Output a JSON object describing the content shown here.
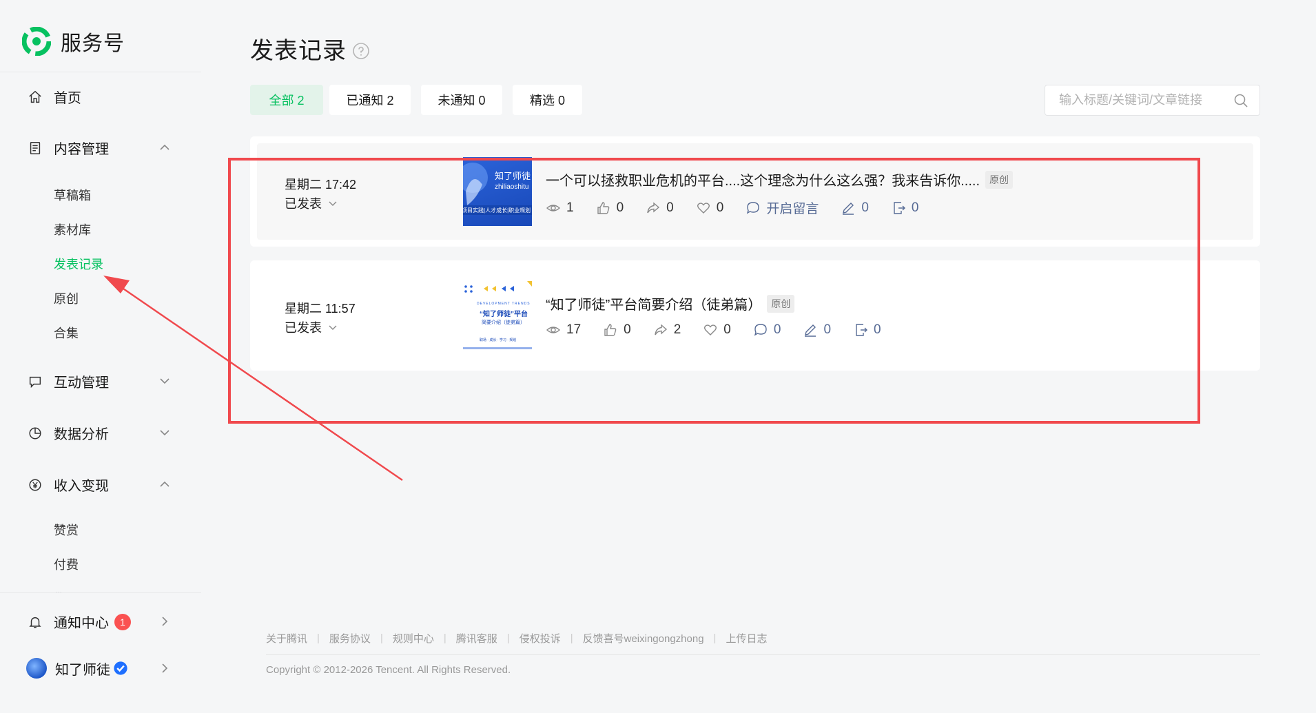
{
  "brand": {
    "name": "服务号"
  },
  "sidebar": {
    "home": "首页",
    "content": {
      "label": "内容管理",
      "subitems": [
        "草稿箱",
        "素材库",
        "发表记录",
        "原创",
        "合集"
      ]
    },
    "interaction": "互动管理",
    "analytics": "数据分析",
    "monetization": {
      "label": "收入变现",
      "subitems": [
        "赞赏",
        "付费"
      ],
      "more": "..."
    },
    "notifications": {
      "label": "通知中心",
      "badge": "1"
    },
    "account": {
      "name": "知了师徒"
    }
  },
  "main": {
    "title": "发表记录",
    "tabs": [
      {
        "label": "全部 2",
        "active": true
      },
      {
        "label": "已通知 2",
        "active": false
      },
      {
        "label": "未通知 0",
        "active": false
      },
      {
        "label": "精选 0",
        "active": false
      }
    ],
    "search": {
      "placeholder": "输入标题/关键词/文章链接"
    },
    "articles": [
      {
        "date": "星期二 17:42",
        "status": "已发表",
        "title": "一个可以拯救职业危机的平台....这个理念为什么这么强？我来告诉你.....",
        "tag": "原创",
        "thumb": {
          "title": "知了师徒",
          "subtitle": "zhiliaoshitu",
          "caption": "项目实践|人才成长|职业规划"
        },
        "stats": {
          "reads": "1",
          "likes": "0",
          "shares": "0",
          "favorites": "0",
          "comments": "开启留言",
          "edits": "0",
          "reposts": "0"
        }
      },
      {
        "date": "星期二 11:57",
        "status": "已发表",
        "title": "“知了师徒”平台简要介绍（徒弟篇）",
        "tag": "原创",
        "thumb": {
          "title": "“知了师徒”平台",
          "subtitle": "简要介绍（徒弟篇）",
          "caption": "DEVELOPMENT TRENDS",
          "footer": "职场 · 成长 · 学习 · 规划"
        },
        "stats": {
          "reads": "17",
          "likes": "0",
          "shares": "2",
          "favorites": "0",
          "comments": "0",
          "edits": "0",
          "reposts": "0"
        }
      }
    ]
  },
  "footer": {
    "links": [
      "关于腾讯",
      "服务协议",
      "规则中心",
      "腾讯客服",
      "侵权投诉",
      "反馈喜号weixingongzhong",
      "上传日志"
    ],
    "copyright": "Copyright © 2012-2026 Tencent. All Rights Reserved."
  },
  "colors": {
    "accent": "#07c160",
    "annotation": "#f0494d",
    "link": "#576b95"
  }
}
